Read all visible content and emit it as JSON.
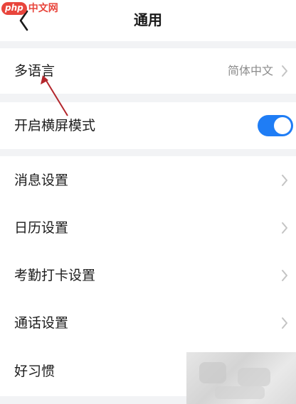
{
  "watermark": {
    "logo_php": "php",
    "logo_cn": "中文网"
  },
  "header": {
    "title": "通用",
    "back_icon": "chevron-left-icon"
  },
  "settings": {
    "language": {
      "label": "多语言",
      "value": "简体中文"
    },
    "landscape": {
      "label": "开启横屏模式",
      "enabled": true
    },
    "items": [
      {
        "label": "消息设置"
      },
      {
        "label": "日历设置"
      },
      {
        "label": "考勤打卡设置"
      },
      {
        "label": "通话设置"
      },
      {
        "label": "好习惯"
      }
    ]
  },
  "colors": {
    "toggle_on": "#1f7df5",
    "annotation_arrow": "#b3262c",
    "background": "#f2f3f5"
  }
}
